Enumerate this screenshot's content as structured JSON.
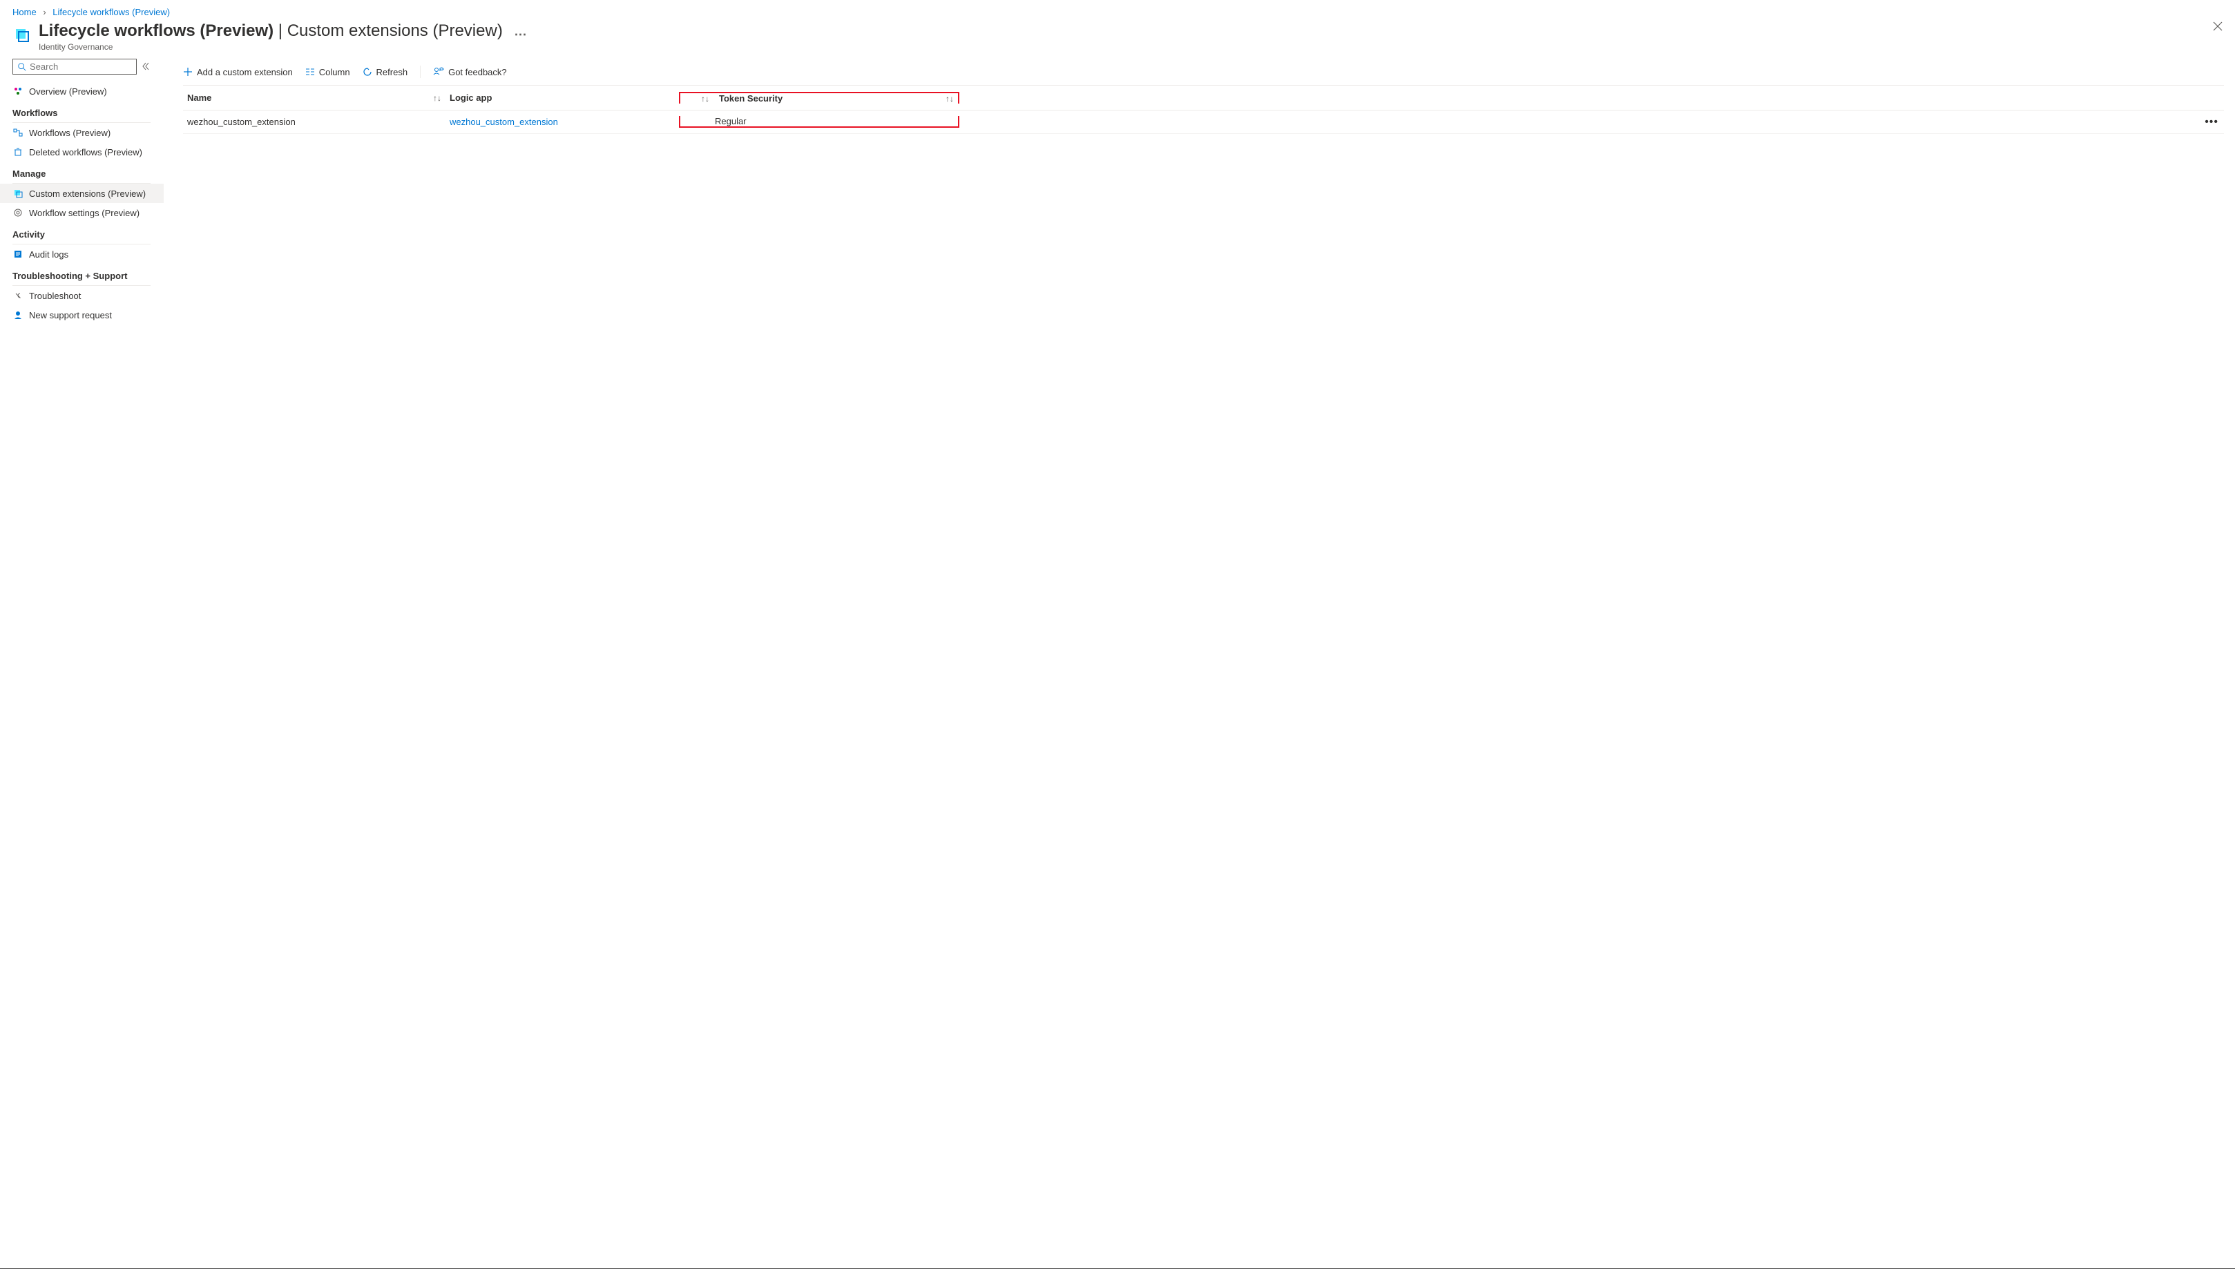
{
  "breadcrumb": {
    "home": "Home",
    "current": "Lifecycle workflows (Preview)"
  },
  "header": {
    "title_strong": "Lifecycle workflows (Preview)",
    "title_sep": " | ",
    "title_rest": "Custom extensions (Preview)",
    "subtitle": "Identity Governance"
  },
  "search": {
    "placeholder": "Search"
  },
  "nav": {
    "overview": "Overview (Preview)",
    "section_workflows": "Workflows",
    "workflows": "Workflows (Preview)",
    "deleted": "Deleted workflows (Preview)",
    "section_manage": "Manage",
    "custom_ext": "Custom extensions (Preview)",
    "wf_settings": "Workflow settings (Preview)",
    "section_activity": "Activity",
    "audit": "Audit logs",
    "section_support": "Troubleshooting + Support",
    "troubleshoot": "Troubleshoot",
    "new_support": "New support request"
  },
  "toolbar": {
    "add": "Add a custom extension",
    "column": "Column",
    "refresh": "Refresh",
    "feedback": "Got feedback?"
  },
  "table": {
    "col_name": "Name",
    "col_logic": "Logic app",
    "col_token": "Token Security",
    "rows": [
      {
        "name": "wezhou_custom_extension",
        "logic": "wezhou_custom_extension",
        "token": "Regular"
      }
    ]
  }
}
